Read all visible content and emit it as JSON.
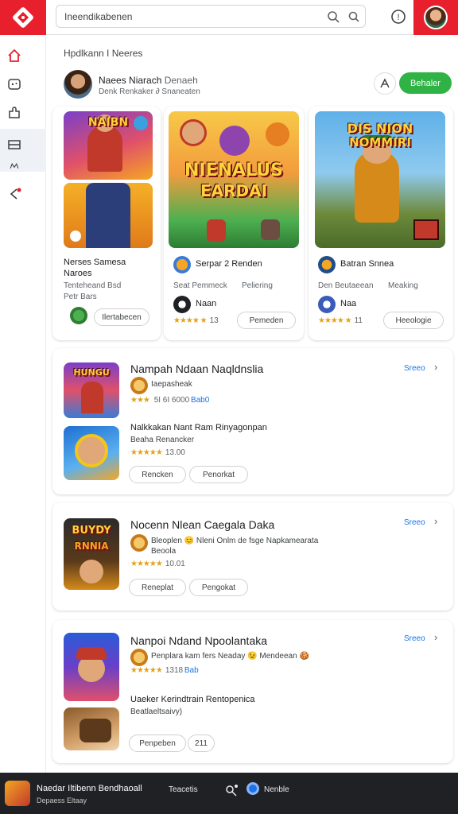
{
  "search": {
    "value": "Ineendikabenen"
  },
  "section_title": "Hpdlkann I Neeres",
  "developer": {
    "name": "Naees Niarach",
    "name_extra": "Denaeh",
    "subtitle": "Denk Renkaker ∂ Snaneaten",
    "follow_label": "Behaler"
  },
  "feature_cards": [
    {
      "title": "Nerses Samesa",
      "title2": "Naroes",
      "line1": "Tenteheand Bsd",
      "line2": "Petr Bars",
      "button": "Ilertabecen",
      "art_label": "NAIBN",
      "art_label2": ""
    },
    {
      "title": "Serpar 2 Renden",
      "meta1": "Seat Pemmeck",
      "meta2": "Peliering",
      "sub_label": "Naan",
      "rating": "★★★★ ★",
      "rating_num": "13",
      "button": "Pemeden",
      "art_label": "NIENALUS",
      "art_label2": "EARDAI"
    },
    {
      "title": "Batran Snnea",
      "meta1": "Den Beutaeean",
      "meta2": "Meaking",
      "sub_label": "Naa",
      "rating": "★★★★ ★",
      "rating_num": "11",
      "button": "Heeologie",
      "art_label": "DIS NION",
      "art_label2": "NOMMIRI"
    }
  ],
  "rows": [
    {
      "title": "Nampah Ndaan Naqldnslia",
      "see_more": "Sreeo",
      "app1": {
        "sub": "Iaepasheak",
        "rating": "★★★",
        "rating_text": "5I 6I 6000",
        "tag": "Bab0",
        "art_label": "HUNGU"
      },
      "app2": {
        "title": "Nalkkakan Nant Ram Rinyagonpan",
        "sub": "Beaha Renancker",
        "rating": "★★★★★",
        "rating_num": "13.00"
      },
      "btn1": "Rencken",
      "btn2": "Penorkat"
    },
    {
      "title": "Nocenn Nlean Caegala Daka",
      "see_more": "Sreeo",
      "app1": {
        "sub": "Bleoplen 😊 Nleni Onlm de fsge Napkamearata",
        "sub2": "Beoola",
        "rating": "★★★★★",
        "rating_num": "10.01",
        "art_label": "BUYDY",
        "art_label2": "RNNIA"
      },
      "btn1": "Reneplat",
      "btn2": "Pengokat"
    },
    {
      "title": "Nanpoi Ndand Npoolantaka",
      "see_more": "Sreeo",
      "app1": {
        "sub": "Penplara kam fers Neaday 😉 Mendeean 🍪",
        "rating": "★★★★★",
        "rating_num": "1318",
        "tag": "Bab"
      },
      "app2": {
        "title": "Uaeker Kerindtrain Rentopenica",
        "sub": "Beatlaeltsaivy)"
      },
      "btn1": "Penpeben",
      "btn2": "211"
    }
  ],
  "bottom": {
    "title": "Naedar Iltibenn Bendhaoall",
    "sub": "Depaess Eltaay",
    "item1": "Teacetis",
    "item2": "Nenble"
  },
  "colors": {
    "accent_red": "#e8202e",
    "green": "#2fb344",
    "link_blue": "#1a73e8"
  }
}
